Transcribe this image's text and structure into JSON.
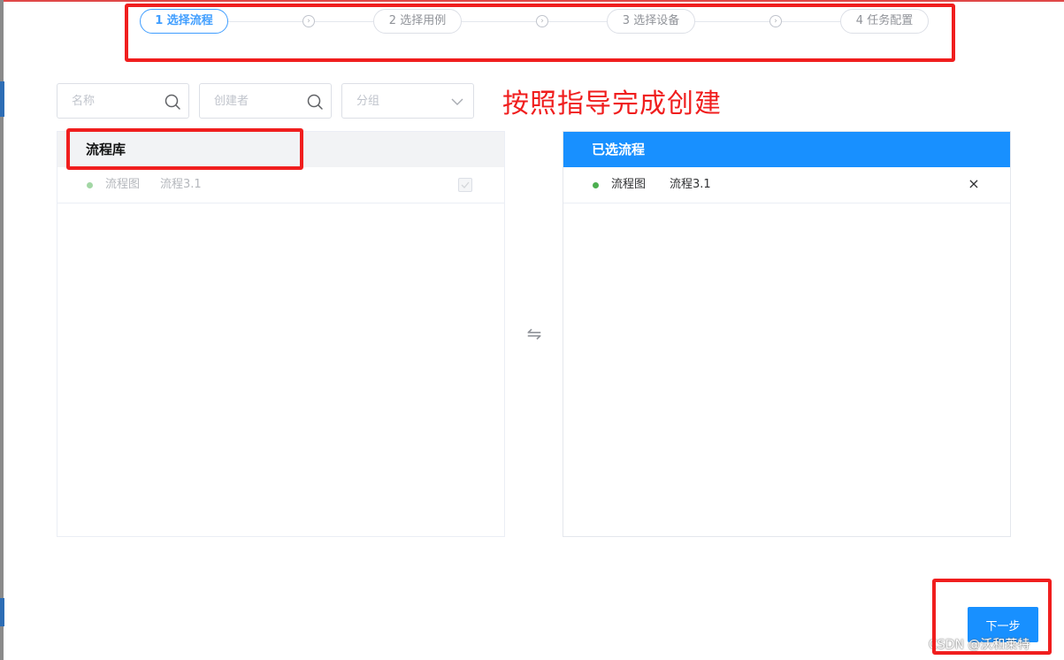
{
  "steps": [
    {
      "label": "1 选择流程",
      "active": true
    },
    {
      "label": "2 选择用例",
      "active": false
    },
    {
      "label": "3 选择设备",
      "active": false
    },
    {
      "label": "4 任务配置",
      "active": false
    }
  ],
  "filters": {
    "name_placeholder": "名称",
    "creator_placeholder": "创建者",
    "group_placeholder": "分组"
  },
  "annotation": {
    "guide_text": "按照指导完成创建",
    "highlight_color": "#f01e1e"
  },
  "left_panel": {
    "title": "流程库",
    "items": [
      {
        "type": "流程图",
        "name": "流程3.1",
        "checked": true,
        "disabled": true
      }
    ]
  },
  "right_panel": {
    "title": "已选流程",
    "items": [
      {
        "type": "流程图",
        "name": "流程3.1"
      }
    ]
  },
  "icons": {
    "search": "search-icon",
    "dropdown": "chevron-down-icon",
    "transfer": "swap-arrows-icon",
    "remove": "close-icon",
    "step_separator": "chevron-right-icon"
  },
  "footer": {
    "next_label": "下一步",
    "watermark": "CSDN @沃和莱特"
  },
  "colors": {
    "primary": "#1890ff",
    "active_step": "#409eff",
    "status_dot": "#4caf50"
  }
}
